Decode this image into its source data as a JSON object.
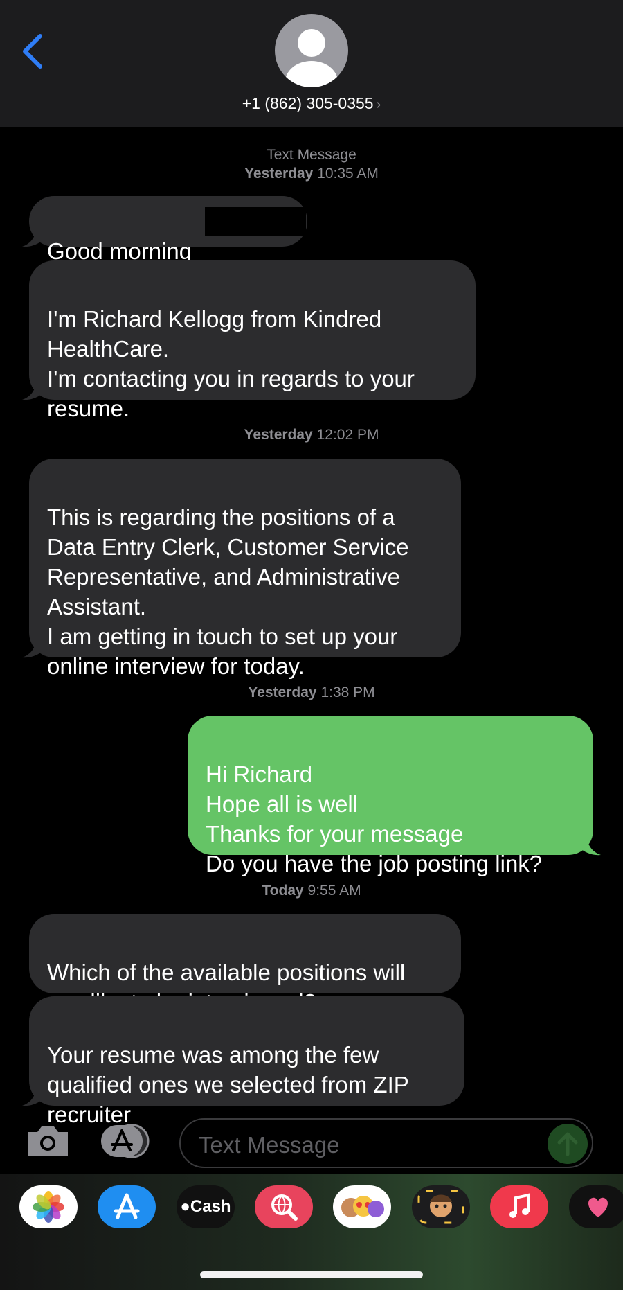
{
  "header": {
    "contact": "+1 (862) 305-0355",
    "chevron": "›",
    "back_icon": "chevron-left-icon",
    "avatar_icon": "person-silhouette-icon",
    "accent": "#2f7df6"
  },
  "conversation": {
    "service_label": "Text Message",
    "timestamps": [
      {
        "day": "Yesterday",
        "time": "10:35 AM"
      },
      {
        "day": "Yesterday",
        "time": "12:02 PM"
      },
      {
        "day": "Yesterday",
        "time": "1:38 PM"
      },
      {
        "day": "Today",
        "time": "9:55 AM"
      }
    ],
    "messages": [
      {
        "dir": "in",
        "text": "Good morning"
      },
      {
        "dir": "in",
        "text": "I'm Richard Kellogg from Kindred\nHealthCare.\nI'm contacting you in regards to your\nresume."
      },
      {
        "dir": "in",
        "text": "This is regarding the positions of a\nData Entry Clerk, Customer Service\nRepresentative, and Administrative\nAssistant.\nI am getting in touch to set up your\nonline interview for today."
      },
      {
        "dir": "out",
        "text": "Hi Richard\nHope all is well\nThanks for your message\nDo you have the job posting link?"
      },
      {
        "dir": "in",
        "text": "Which of the available positions will\nyou like to be interviewed?"
      },
      {
        "dir": "in",
        "text": "Your resume was among the few\nqualified ones we selected from ZIP\nrecruiter"
      }
    ]
  },
  "composer": {
    "placeholder": "Text Message",
    "camera_icon": "camera-icon",
    "apps_icon": "app-store-icon",
    "send_icon": "arrow-up-icon"
  },
  "drawer": {
    "apps": [
      {
        "name": "photos-app-icon"
      },
      {
        "name": "app-store-app-icon"
      },
      {
        "name": "apple-cash-app-icon",
        "label": "Cash"
      },
      {
        "name": "web-search-app-icon"
      },
      {
        "name": "memoji-stickers-app-icon"
      },
      {
        "name": "memoji-app-icon"
      },
      {
        "name": "music-app-icon"
      },
      {
        "name": "digital-touch-app-icon"
      }
    ]
  },
  "colors": {
    "incoming": "#2c2c2e",
    "outgoing": "#65c466",
    "meta": "#8e8e93"
  }
}
